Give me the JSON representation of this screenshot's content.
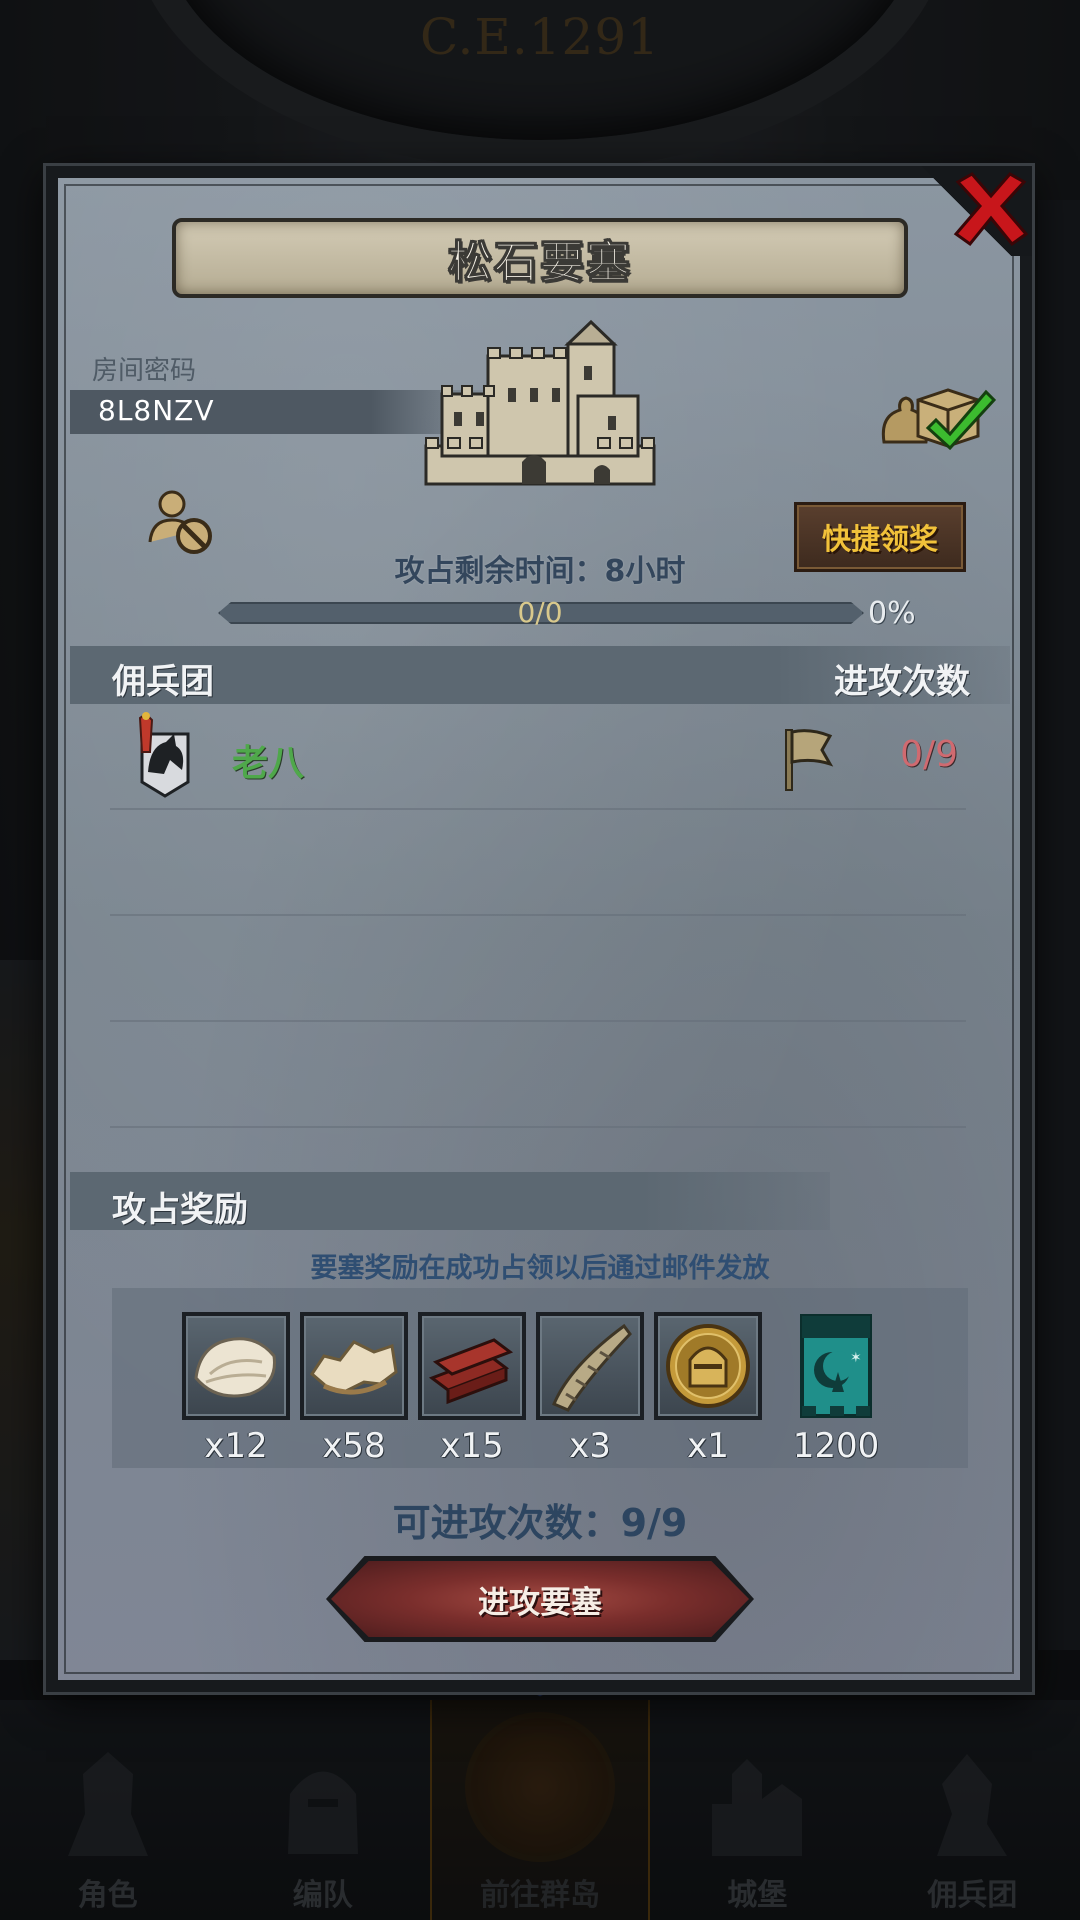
{
  "background": {
    "year_label": "C.E.1291"
  },
  "dialog": {
    "title": "松石要塞",
    "room_password_label": "房间密码",
    "room_code": "8L8NZV",
    "quick_claim_label": "快捷领奖",
    "timer_text": "攻占剩余时间：8小时",
    "progress": {
      "current": 0,
      "total": 0,
      "label": "0/0",
      "percent_label": "0%",
      "fraction": 0
    },
    "mercenary_header": "佣兵团",
    "attack_count_header": "进攻次数",
    "mercenaries": [
      {
        "name": "老八",
        "attacks": "0/9"
      }
    ],
    "reward_header": "攻占奖励",
    "reward_note": "要塞奖励在成功占领以后通过邮件发放",
    "rewards": [
      {
        "icon": "fleece-icon",
        "qty": "x12"
      },
      {
        "icon": "fur-pelt-icon",
        "qty": "x58"
      },
      {
        "icon": "timber-icon",
        "qty": "x15"
      },
      {
        "icon": "horn-icon",
        "qty": "x3"
      },
      {
        "icon": "knight-helmet-coin-icon",
        "qty": "x1"
      },
      {
        "icon": "guild-banner-icon",
        "qty": "1200"
      }
    ],
    "attempts_text": "可进攻次数：9/9",
    "attack_button_label": "进攻要塞"
  },
  "bottom_nav": {
    "items": [
      {
        "label": "角色",
        "icon": "knight-icon"
      },
      {
        "label": "编队",
        "icon": "helmet-icon"
      },
      {
        "label": "前往群岛",
        "icon": "globe-icon",
        "active": true
      },
      {
        "label": "城堡",
        "icon": "castle-icon"
      },
      {
        "label": "佣兵团",
        "icon": "mercenary-icon"
      }
    ]
  },
  "colors": {
    "accent_gold": "#f2c23a",
    "name_green": "#4fa84b",
    "count_red": "#d06a70",
    "button_red": "#7a2e2c",
    "panel_gray": "#7f8a95"
  }
}
